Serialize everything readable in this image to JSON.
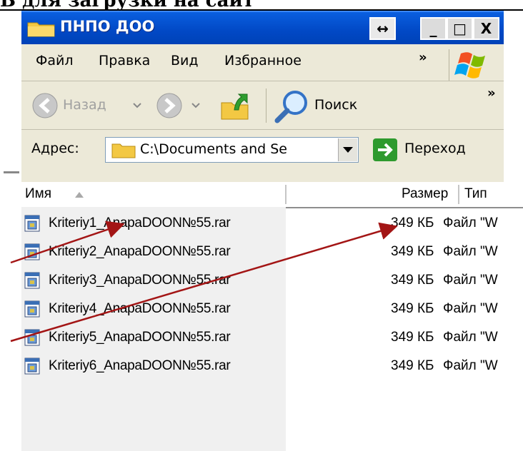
{
  "heading": "В для загрузки на сайт",
  "window": {
    "title": "ПНПО ДОО",
    "controls": {
      "restore": "↔",
      "minimize": "_",
      "maximize": "□",
      "close": "X"
    }
  },
  "menu": [
    "Файл",
    "Правка",
    "Вид",
    "Избранное"
  ],
  "overflow_chevron": "»",
  "toolbar": {
    "back_label": "Назад",
    "search_label": "Поиск"
  },
  "address": {
    "label": "Адрес:",
    "path": "C:\\Documents and Se",
    "go_label": "Переход"
  },
  "columns": {
    "name": "Имя",
    "size": "Размер",
    "type": "Тип"
  },
  "files": [
    {
      "name": "Kriteriy1_AnapaDOON№55.rar",
      "size": "349 КБ",
      "type": "Файл \"W"
    },
    {
      "name": "Kriteriy2_AnapaDOON№55.rar",
      "size": "349 КБ",
      "type": "Файл \"W"
    },
    {
      "name": "Kriteriy3_AnapaDOON№55.rar",
      "size": "349 КБ",
      "type": "Файл \"W"
    },
    {
      "name": "Kriteriy4_AnapaDOON№55.rar",
      "size": "349 КБ",
      "type": "Файл \"W"
    },
    {
      "name": "Kriteriy5_AnapaDOON№55.rar",
      "size": "349 КБ",
      "type": "Файл \"W"
    },
    {
      "name": "Kriteriy6_AnapaDOON№55.rar",
      "size": "349 КБ",
      "type": "Файл \"W"
    }
  ],
  "icons": {
    "title": "folder-icon",
    "back": "back-arrow-icon",
    "forward": "forward-arrow-icon",
    "up": "folder-up-icon",
    "search": "magnifier-icon",
    "go": "green-go-arrow-icon",
    "file": "rar-archive-icon",
    "logo": "windows-logo-icon"
  },
  "colors": {
    "titlebar": "#0148c5",
    "window": "#ece9d8",
    "annotation_arrow": "#a31515"
  }
}
